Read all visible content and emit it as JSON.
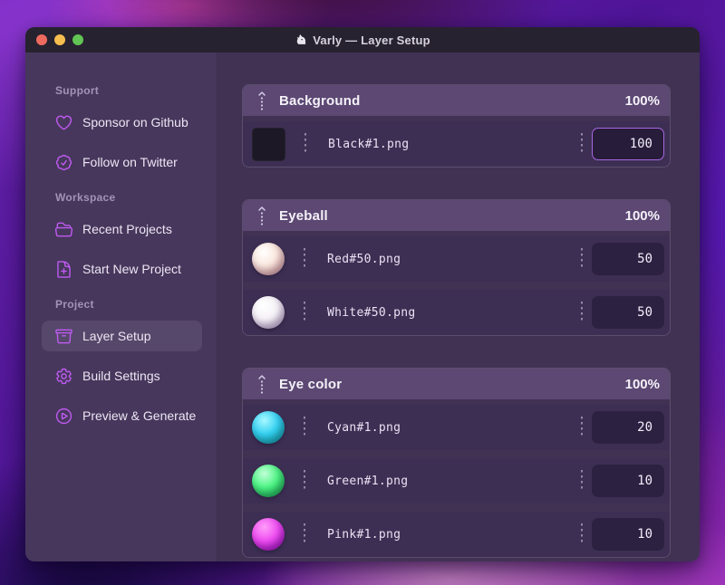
{
  "window": {
    "title": "Varly — Layer Setup",
    "icon": "unicorn-icon",
    "traffic_lights": {
      "close": "#ee6a5e",
      "minimize": "#f5be4f",
      "zoom": "#61c454"
    }
  },
  "sidebar": {
    "sections": [
      {
        "label": "Support",
        "items": [
          {
            "icon": "heart-icon",
            "label": "Sponsor on Github"
          },
          {
            "icon": "badge-check-icon",
            "label": "Follow on Twitter"
          }
        ]
      },
      {
        "label": "Workspace",
        "items": [
          {
            "icon": "folder-open-icon",
            "label": "Recent Projects"
          },
          {
            "icon": "document-plus-icon",
            "label": "Start New Project"
          }
        ]
      },
      {
        "label": "Project",
        "items": [
          {
            "icon": "archive-box-icon",
            "label": "Layer Setup",
            "selected": true
          },
          {
            "icon": "gear-icon",
            "label": "Build Settings"
          },
          {
            "icon": "play-circle-icon",
            "label": "Preview & Generate"
          }
        ]
      }
    ]
  },
  "layers": {
    "groups": [
      {
        "name": "Background",
        "percent": "100%",
        "items": [
          {
            "file": "Black#1.png",
            "value": "100",
            "thumb": "black-square",
            "focused": true
          }
        ]
      },
      {
        "name": "Eyeball",
        "percent": "100%",
        "items": [
          {
            "file": "Red#50.png",
            "value": "50",
            "thumb": "red-ball"
          },
          {
            "file": "White#50.png",
            "value": "50",
            "thumb": "white-ball"
          }
        ]
      },
      {
        "name": "Eye color",
        "percent": "100%",
        "items": [
          {
            "file": "Cyan#1.png",
            "value": "20",
            "thumb": "cyan-ball"
          },
          {
            "file": "Green#1.png",
            "value": "10",
            "thumb": "green-ball"
          },
          {
            "file": "Pink#1.png",
            "value": "10",
            "thumb": "pink-ball"
          }
        ]
      }
    ]
  },
  "colors": {
    "accent_purple": "#bf5af2",
    "focused_input_border": "#a765e0",
    "sidebar_bg": "#47375c",
    "content_bg": "#413254",
    "group_header_bg": "#5c4873",
    "row_bg": "#3d2f53",
    "titlebar_bg": "#27222f"
  }
}
